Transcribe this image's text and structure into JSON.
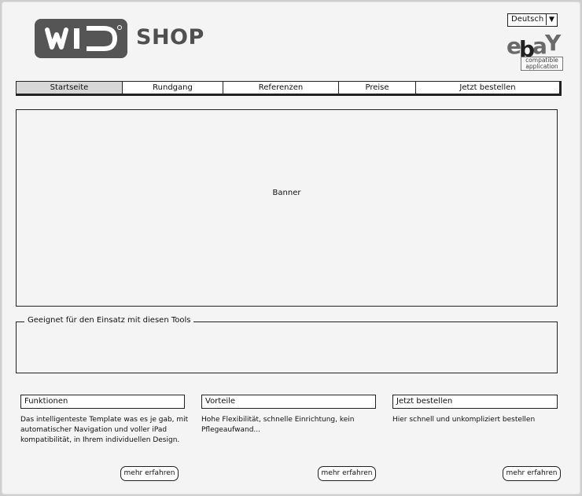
{
  "header": {
    "logo_text": "WID",
    "shop_label": "SHOP",
    "language": {
      "selected": "Deutsch"
    },
    "ebay_badge": {
      "word_e": "e",
      "word_b": "b",
      "word_a": "a",
      "word_y": "Y",
      "tagline": "compatible application"
    }
  },
  "nav": {
    "tabs": [
      {
        "label": "Startseite",
        "active": true
      },
      {
        "label": "Rundgang",
        "active": false
      },
      {
        "label": "Referenzen",
        "active": false
      },
      {
        "label": "Preise",
        "active": false
      },
      {
        "label": "Jetzt bestellen",
        "active": false
      }
    ]
  },
  "banner": {
    "label": "Banner"
  },
  "tools": {
    "legend": "Geeignet für den Einsatz mit diesen Tools"
  },
  "columns": [
    {
      "title": "Funktionen",
      "text": "Das intelligenteste Template was es je gab, mit automatischer Navigation und voller iPad kompatibilität, in Ihrem individuellen Design.",
      "button": "mehr erfahren"
    },
    {
      "title": "Vorteile",
      "text": "Hohe Flexibilität, schnelle Einrichtung, kein Pflegeaufwand...",
      "button": "mehr erfahren"
    },
    {
      "title": "Jetzt bestellen",
      "text": "Hier schnell und unkompliziert bestellen",
      "button": "mehr erfahren"
    }
  ],
  "colors": {
    "logo_bg": "#555555",
    "page_bg": "#f4f4f4",
    "active_tab": "#d7d7d7",
    "border": "#222222"
  },
  "icons": {
    "dropdown": "triangle-down-icon"
  }
}
